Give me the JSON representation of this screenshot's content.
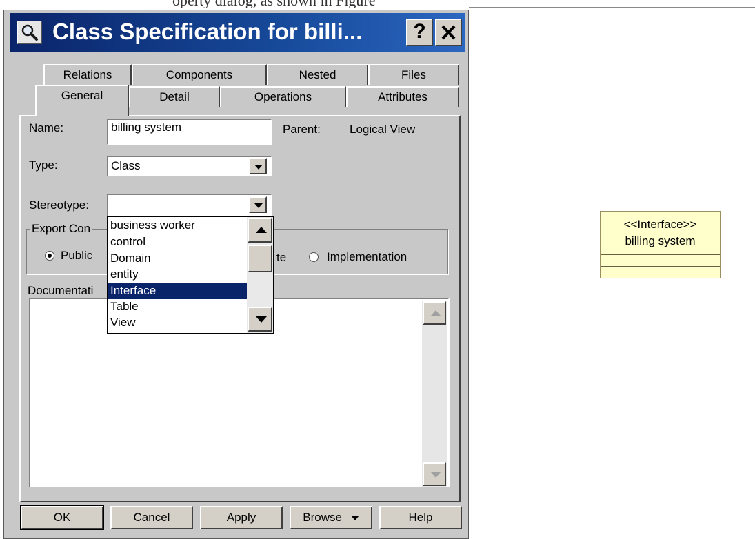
{
  "page_top": {
    "cut_off_text": "operty dialog, as shown in Figure"
  },
  "dialog": {
    "title": "Class Specification for billi...",
    "help_label": "?",
    "close_label": "✕",
    "tabs_row_back": [
      "Relations",
      "Components",
      "Nested",
      "Files"
    ],
    "tabs_row_front": [
      "General",
      "Detail",
      "Operations",
      "Attributes"
    ],
    "active_tab": "General",
    "general": {
      "name_label": "Name:",
      "name_value": "billing system",
      "parent_label": "Parent:",
      "parent_value": "Logical View",
      "type_label": "Type:",
      "type_value": "Class",
      "stereotype_label": "Stereotype:",
      "stereotype_value": "",
      "export_label": "Export Con",
      "export_options": [
        "Public",
        "te",
        "Implementation"
      ],
      "export_selected": "Public",
      "documentation_label": "Documentati",
      "documentation_value": ""
    },
    "stereotype_dropdown": {
      "options": [
        "business worker",
        "control",
        "Domain",
        "entity",
        "Interface",
        "Table",
        "View"
      ],
      "highlighted": "Interface"
    },
    "buttons": {
      "ok": "OK",
      "cancel": "Cancel",
      "apply": "Apply",
      "browse": "Browse",
      "help": "Help"
    }
  },
  "uml_class": {
    "stereotype": "<<Interface>>",
    "name": "billing system"
  }
}
